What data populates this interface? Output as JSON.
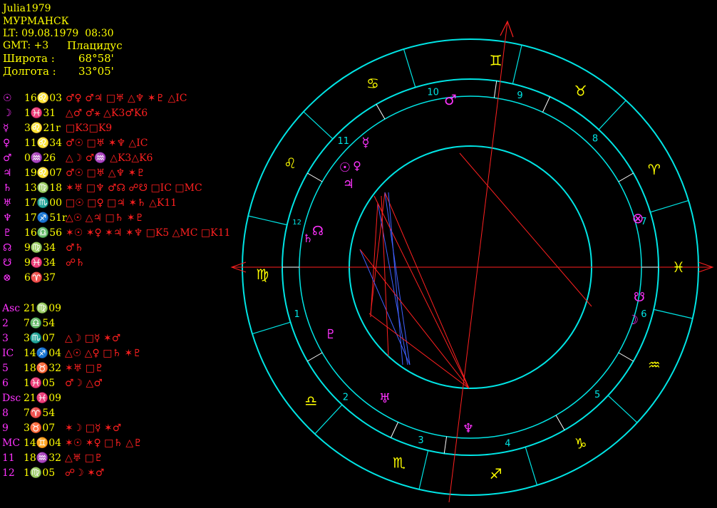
{
  "header": {
    "name": "Julia1979",
    "city": "МУРМАНСК",
    "local_time": "LT: 09.08.1979  08:30",
    "gmt": "GMT: +3",
    "house_system": "Плацидус",
    "latitude_label": "Широта :",
    "latitude_value": "68°58'",
    "longitude_label": "Долгота :",
    "longitude_value": "33°05'"
  },
  "planets": [
    {
      "glyph": "☉",
      "position": "16♌03",
      "aspects": "♂♀ ♂♃ □♅ △♆ ✶♇ △IC"
    },
    {
      "glyph": "☽",
      "position": " 1♓31",
      "aspects": "△♂ ♂⚹ △K3♂K6"
    },
    {
      "glyph": "☿",
      "position": " 3♌21r",
      "aspects": "□K3□K9"
    },
    {
      "glyph": "♀",
      "position": "11♌34",
      "aspects": "♂☉ □♅ ✶♆ △IC"
    },
    {
      "glyph": "♂",
      "position": " 0♒26",
      "aspects": "△☽ ♂♒ △K3△K6"
    },
    {
      "glyph": "♃",
      "position": "19♌07",
      "aspects": "♂☉ □♅ △♆ ✶♇"
    },
    {
      "glyph": "♄",
      "position": "13♍18",
      "aspects": "✶♅ □♆ ♂☊ ☍☋ □IC □MC"
    },
    {
      "glyph": "♅",
      "position": "17♏00",
      "aspects": "□☉ □♀ □♃ ✶♄ △K11"
    },
    {
      "glyph": "♆",
      "position": "17♐51r",
      "aspects": "△☉ △♃ □♄ ✶♇"
    },
    {
      "glyph": "♇",
      "position": "16♎56",
      "aspects": "✶☉ ✶♀ ✶♃ ✶♆ □K5 △MC □K11"
    },
    {
      "glyph": "☊",
      "position": " 9♍34",
      "aspects": "♂♄"
    },
    {
      "glyph": "☋",
      "position": " 9♓34",
      "aspects": "☍♄"
    },
    {
      "glyph": "⊗",
      "position": " 6♈37",
      "aspects": ""
    }
  ],
  "houses": [
    {
      "label": "Asc",
      "position": "21♍09",
      "aspects": ""
    },
    {
      "label": "2",
      "position": " 7♎54",
      "aspects": ""
    },
    {
      "label": "3",
      "position": " 3♏07",
      "aspects": "△☽ □☿ ✶♂"
    },
    {
      "label": "IC",
      "position": "14♐04",
      "aspects": "△☉ △♀ □♄ ✶♇"
    },
    {
      "label": "5",
      "position": "18♉32",
      "aspects": "✶♅ □♇"
    },
    {
      "label": "6",
      "position": " 1♓05",
      "aspects": "♂☽ △♂"
    },
    {
      "label": "Dsc",
      "position": "21♓09",
      "aspects": ""
    },
    {
      "label": "8",
      "position": " 7♈54",
      "aspects": ""
    },
    {
      "label": "9",
      "position": " 3♉07",
      "aspects": "✶☽ □☿ ✶♂"
    },
    {
      "label": "MC",
      "position": "14♊04",
      "aspects": "✶☉ ✶♀ □♄ △♇"
    },
    {
      "label": "11",
      "position": "18♒32",
      "aspects": "△♅ □♇"
    },
    {
      "label": "12",
      "position": " 1♍05",
      "aspects": "☍☽ ✶♂"
    }
  ],
  "wheel": {
    "zodiac_glyphs": [
      "♊",
      "♉",
      "♈",
      "♓",
      "♒",
      "♑",
      "♐",
      "♏",
      "♎",
      "♍",
      "♌",
      "♋"
    ],
    "house_numbers": [
      "1",
      "2",
      "3",
      "4",
      "5",
      "6",
      "7",
      "8",
      "9",
      "10",
      "11",
      "12"
    ],
    "planet_markers": [
      {
        "name": "mars",
        "glyph": "♂"
      },
      {
        "name": "mercury",
        "glyph": "☿"
      },
      {
        "name": "sun",
        "glyph": "☉"
      },
      {
        "name": "venus",
        "glyph": "♀"
      },
      {
        "name": "jupiter",
        "glyph": "♃"
      },
      {
        "name": "north-node",
        "glyph": "☊"
      },
      {
        "name": "saturn",
        "glyph": "♄"
      },
      {
        "name": "part-of-fortune",
        "glyph": "⊗"
      },
      {
        "name": "south-node",
        "glyph": "☋"
      },
      {
        "name": "moon",
        "glyph": "☽"
      },
      {
        "name": "pluto",
        "glyph": "♇"
      },
      {
        "name": "uranus",
        "glyph": "♅"
      },
      {
        "name": "neptune",
        "glyph": "♆"
      }
    ]
  },
  "colors": {
    "background": "#000000",
    "text_yellow": "#ffff00",
    "label_magenta": "#ff33ff",
    "aspect_red": "#ff2020",
    "wheel_cyan": "#00e5e5",
    "aspect_blue": "#4060ff"
  }
}
